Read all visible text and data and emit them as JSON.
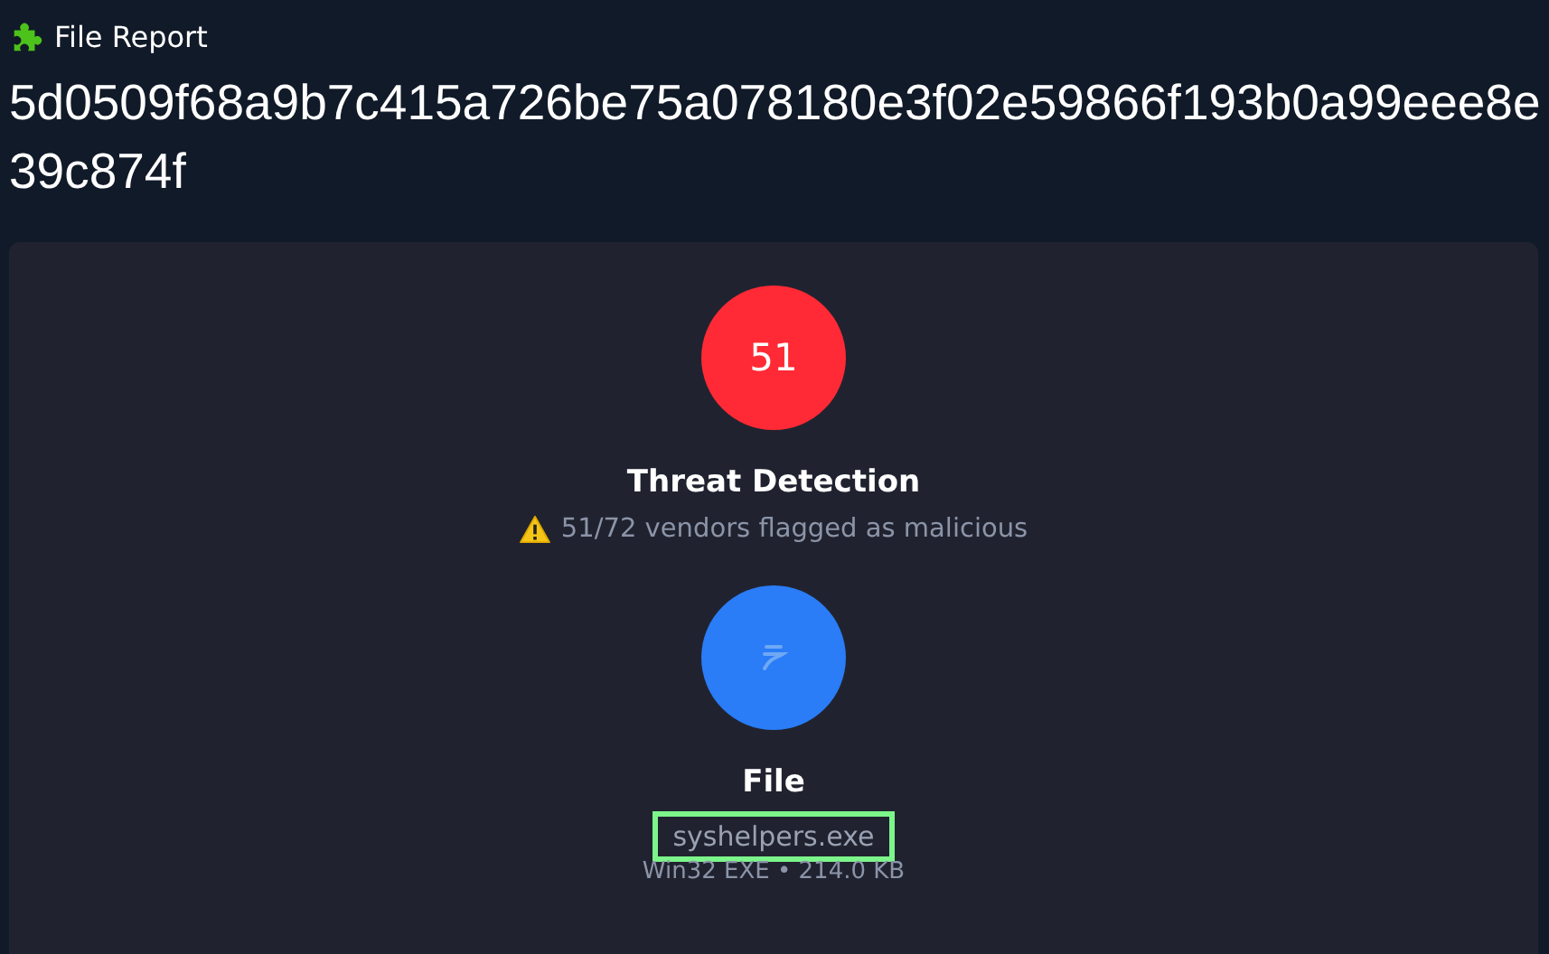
{
  "header": {
    "label": "File Report"
  },
  "hash": "5d0509f68a9b7c415a726be75a078180e3f02e59866f193b0a99eee8e39c874f",
  "detection": {
    "score": "51",
    "title": "Threat Detection",
    "summary": "51/72 vendors flagged as malicious"
  },
  "file": {
    "title": "File",
    "name": "syshelpers.exe",
    "name_highlighted": true,
    "meta": "Win32 EXE • 214.0 KB"
  }
}
